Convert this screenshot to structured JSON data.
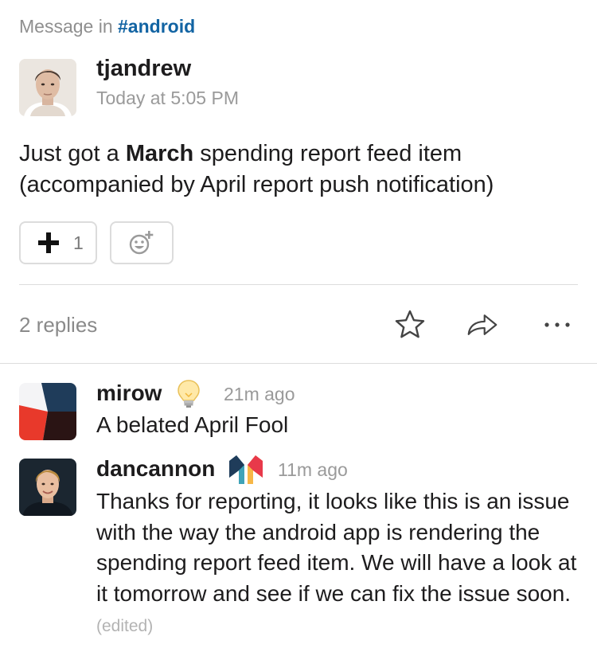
{
  "header": {
    "prefix": "Message in",
    "channel": "#android"
  },
  "message": {
    "author": "tjandrew",
    "timestamp": "Today at 5:05 PM",
    "text_before": "Just got a ",
    "text_bold": "March",
    "text_after": " spending report feed item (accompanied by April report push notification)",
    "reactions": [
      {
        "icon": "heavy-plus-icon",
        "count": "1"
      },
      {
        "icon": "add-reaction-icon"
      }
    ]
  },
  "thread": {
    "replies_label": "2 replies",
    "actions": [
      "star-icon",
      "share-arrow-icon",
      "more-ellipsis-icon"
    ]
  },
  "replies": [
    {
      "author": "mirow",
      "badge": "lightbulb-icon",
      "time": "21m ago",
      "text": "A belated April Fool"
    },
    {
      "author": "dancannon",
      "badge": "monzo-logo-icon",
      "time": "11m ago",
      "text": "Thanks for reporting, it looks like this is an issue with the way the android app is rendering the spending report feed item. We will have a look at it tomorrow and see if we can fix the issue soon.",
      "edited": "(edited)"
    }
  ],
  "colors": {
    "channel_link": "#1264a3",
    "muted_text": "#8f8f8f",
    "divider": "#dddddd",
    "monzo_red": "#e8394a",
    "monzo_teal": "#3fa3b8",
    "monzo_navy": "#1f3c5a",
    "monzo_yellow": "#f7b747"
  }
}
